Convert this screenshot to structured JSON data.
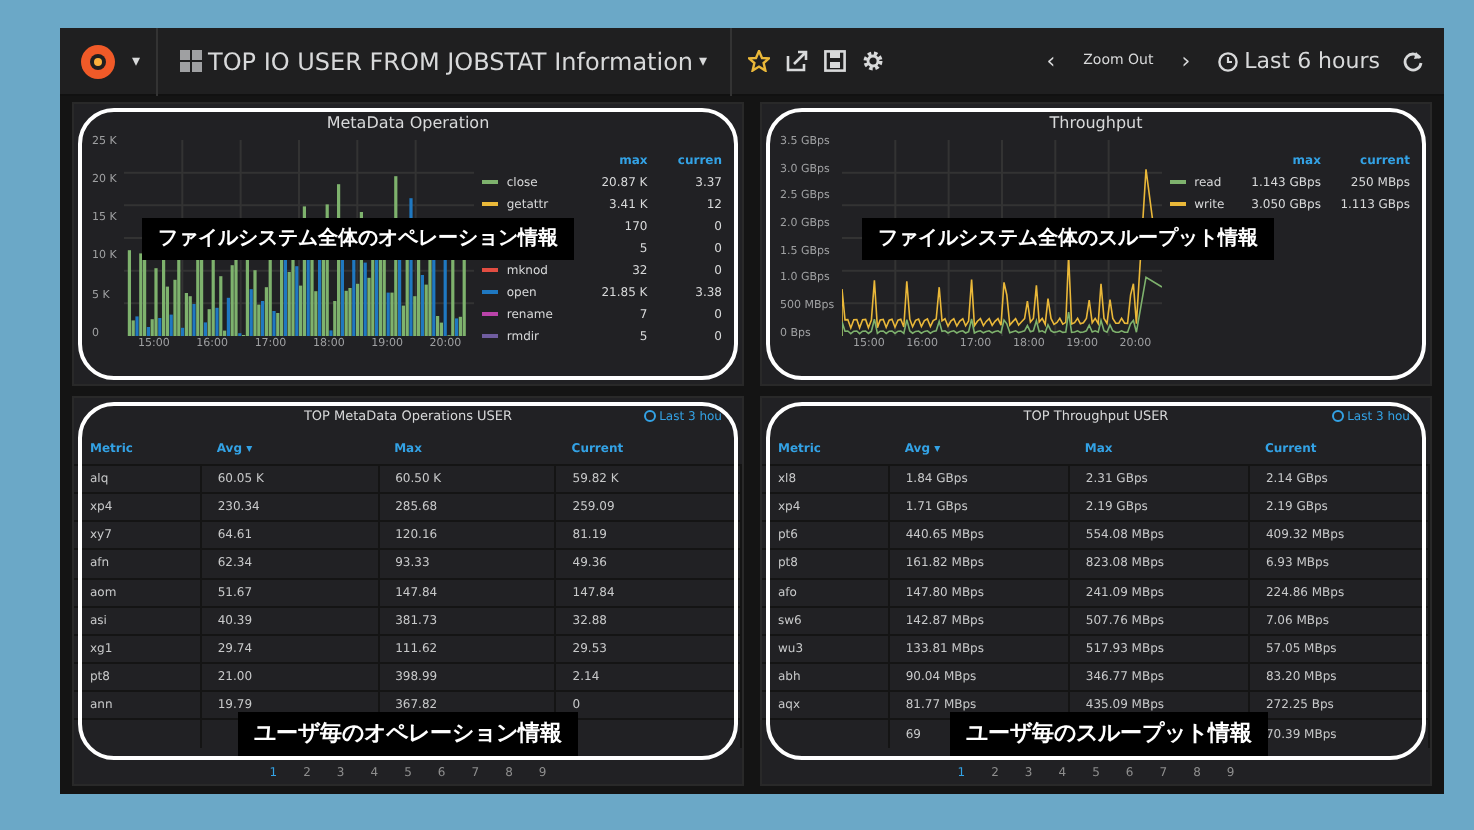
{
  "topbar": {
    "title": "TOP IO USER FROM JOBSTAT Information",
    "title_caret": "▾",
    "logo_caret": "▾",
    "starred": true,
    "prev": "‹",
    "zoom_out": "Zoom Out",
    "next": "›",
    "time_range": "Last 6 hours"
  },
  "charts": [
    {
      "title": "MetaData Operation",
      "kind": "bars",
      "yticks": [
        "25 K",
        "20 K",
        "15 K",
        "10 K",
        "5 K",
        "0"
      ],
      "xticks": [
        "15:00",
        "16:00",
        "17:00",
        "18:00",
        "19:00",
        "20:00"
      ],
      "legend_headers": [
        "max",
        "curren"
      ],
      "legend": [
        {
          "name": "close",
          "color": "#7eb26d",
          "max": "20.87 K",
          "current": "3.37"
        },
        {
          "name": "getattr",
          "color": "#eab839",
          "max": "3.41 K",
          "current": "12"
        },
        {
          "max": "170",
          "current": "0"
        },
        {
          "max": "5",
          "current": "0"
        },
        {
          "name": "mknod",
          "color": "#e24d42",
          "max": "32",
          "current": "0"
        },
        {
          "name": "open",
          "color": "#1f78c1",
          "max": "21.85 K",
          "current": "3.38"
        },
        {
          "name": "rename",
          "color": "#ba43a9",
          "max": "7",
          "current": "0"
        },
        {
          "name": "rmdir",
          "color": "#705da0",
          "max": "5",
          "current": "0"
        }
      ],
      "annotation": "ファイルシステム全体のオペレーション情報"
    },
    {
      "title": "Throughput",
      "kind": "lines",
      "yticks": [
        "3.5 GBps",
        "3.0 GBps",
        "2.5 GBps",
        "2.0 GBps",
        "1.5 GBps",
        "1.0 GBps",
        "500 MBps",
        "0 Bps"
      ],
      "xticks": [
        "15:00",
        "16:00",
        "17:00",
        "18:00",
        "19:00",
        "20:00"
      ],
      "legend_headers": [
        "max",
        "current"
      ],
      "legend": [
        {
          "name": "read",
          "color": "#7eb26d",
          "max": "1.143 GBps",
          "current": "250 MBps"
        },
        {
          "name": "write",
          "color": "#eab839",
          "max": "3.050 GBps",
          "current": "1.113 GBps"
        }
      ],
      "annotation": "ファイルシステム全体のスループット情報"
    }
  ],
  "tables": [
    {
      "title": "TOP MetaData Operations USER",
      "range": "Last 3 hou",
      "columns": [
        {
          "label": "Metric",
          "sorted": false
        },
        {
          "label": "Avg",
          "sorted": true
        },
        {
          "label": "Max",
          "sorted": false
        },
        {
          "label": "Current",
          "sorted": false
        }
      ],
      "sort_mark": "▾",
      "rows": [
        [
          "alq",
          "60.05 K",
          "60.50 K",
          "59.82 K"
        ],
        [
          "xp4",
          "230.34",
          "285.68",
          "259.09"
        ],
        [
          "xy7",
          "64.61",
          "120.16",
          "81.19"
        ],
        [
          "afn",
          "62.34",
          "93.33",
          "49.36"
        ],
        [
          "aom",
          "51.67",
          "147.84",
          "147.84"
        ],
        [
          "asi",
          "40.39",
          "381.73",
          "32.88"
        ],
        [
          "xg1",
          "29.74",
          "111.62",
          "29.53"
        ],
        [
          "pt8",
          "21.00",
          "398.99",
          "2.14"
        ],
        [
          "ann",
          "19.79",
          "367.82",
          "0"
        ],
        [
          null,
          null,
          null,
          null
        ]
      ],
      "pages": [
        {
          "label": "1",
          "selected": true
        },
        {
          "label": "2",
          "selected": false
        },
        {
          "label": "3",
          "selected": false
        },
        {
          "label": "4",
          "selected": false
        },
        {
          "label": "5",
          "selected": false
        },
        {
          "label": "6",
          "selected": false
        },
        {
          "label": "7",
          "selected": false
        },
        {
          "label": "8",
          "selected": false
        },
        {
          "label": "9",
          "selected": false
        }
      ],
      "annotation": "ユーザ毎のオペレーション情報"
    },
    {
      "title": "TOP Throughput USER",
      "range": "Last 3 hou",
      "columns": [
        {
          "label": "Metric",
          "sorted": false
        },
        {
          "label": "Avg",
          "sorted": true
        },
        {
          "label": "Max",
          "sorted": false
        },
        {
          "label": "Current",
          "sorted": false
        }
      ],
      "sort_mark": "▾",
      "rows": [
        [
          "xl8",
          "1.84 GBps",
          "2.31 GBps",
          "2.14 GBps"
        ],
        [
          "xp4",
          "1.71 GBps",
          "2.19 GBps",
          "2.19 GBps"
        ],
        [
          "pt6",
          "440.65 MBps",
          "554.08 MBps",
          "409.32 MBps"
        ],
        [
          "pt8",
          "161.82 MBps",
          "823.08 MBps",
          "6.93 MBps"
        ],
        [
          "afo",
          "147.80 MBps",
          "241.09 MBps",
          "224.86 MBps"
        ],
        [
          "sw6",
          "142.87 MBps",
          "507.76 MBps",
          "7.06 MBps"
        ],
        [
          "wu3",
          "133.81 MBps",
          "517.93 MBps",
          "57.05 MBps"
        ],
        [
          "abh",
          "90.04 MBps",
          "346.77 MBps",
          "83.20 MBps"
        ],
        [
          "aqx",
          "81.77 MBps",
          "435.09 MBps",
          "272.25 Bps"
        ],
        [
          null,
          "69",
          null,
          "70.39 MBps"
        ]
      ],
      "pages": [
        {
          "label": "1",
          "selected": true
        },
        {
          "label": "2",
          "selected": false
        },
        {
          "label": "3",
          "selected": false
        },
        {
          "label": "4",
          "selected": false
        },
        {
          "label": "5",
          "selected": false
        },
        {
          "label": "6",
          "selected": false
        },
        {
          "label": "7",
          "selected": false
        },
        {
          "label": "8",
          "selected": false
        },
        {
          "label": "9",
          "selected": false
        }
      ],
      "annotation": "ユーザ毎のスループット情報"
    }
  ]
}
